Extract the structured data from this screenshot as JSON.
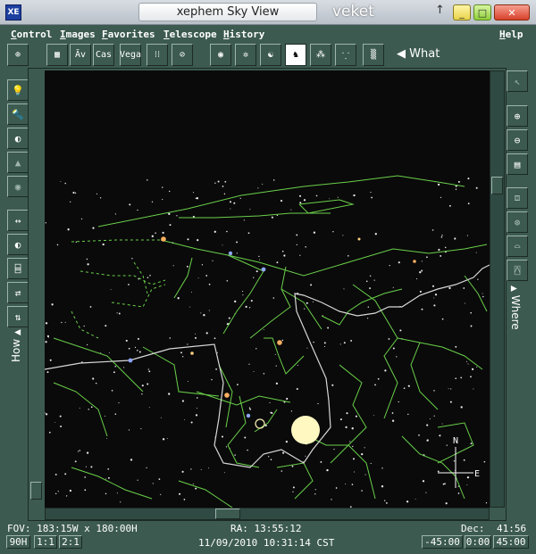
{
  "window": {
    "logo": "XE",
    "title": "xephem Sky View",
    "host": "veket",
    "arrow": "↑",
    "min": "_",
    "max": "□",
    "close": "✕"
  },
  "menus": [
    "Control",
    "Images",
    "Favorites",
    "Telescope",
    "History",
    "Help"
  ],
  "toolbar": {
    "what_label": "What",
    "what_arrow": "◀",
    "buttons": [
      "⊚",
      "▦",
      "Ăv",
      "Cas",
      "Vega",
      "⁝⁝",
      "⊘",
      "◉",
      "✲",
      "☯",
      "♞",
      "⁂",
      "⸪",
      "▒"
    ]
  },
  "left_tools": [
    "💡",
    "🔦",
    "◐",
    "▲",
    "◉",
    "↔",
    "◐",
    "⌸",
    "⇄",
    "⇅"
  ],
  "left_label": "How",
  "left_label_arrow": "▲",
  "right_tools": [
    "↖",
    "⊕",
    "⊖",
    "▤",
    "⧈",
    "⊛",
    "⌓",
    "⍓"
  ],
  "right_label": "Where",
  "right_label_arrow": "▲",
  "status": {
    "fov": "FOV: 183:15W x 180:00H",
    "ra": "RA: 13:55:12",
    "dec_label": "Dec:",
    "dec_value": "41:56",
    "datetime": "11/09/2010 10:31:14 CST",
    "btn_90h": "90H",
    "btn_11": "1:1",
    "btn_21": "2:1",
    "alt1": "-45:00",
    "alt2": "0:00",
    "alt3": "45:00"
  },
  "compass": {
    "north": "N",
    "east": "E"
  },
  "colors": {
    "frame": "#3c5a50",
    "sky": "#0a0a0a",
    "constellation": "#6ad04a",
    "horizon": "#d8d8d8",
    "sun": "#fff8c0"
  }
}
